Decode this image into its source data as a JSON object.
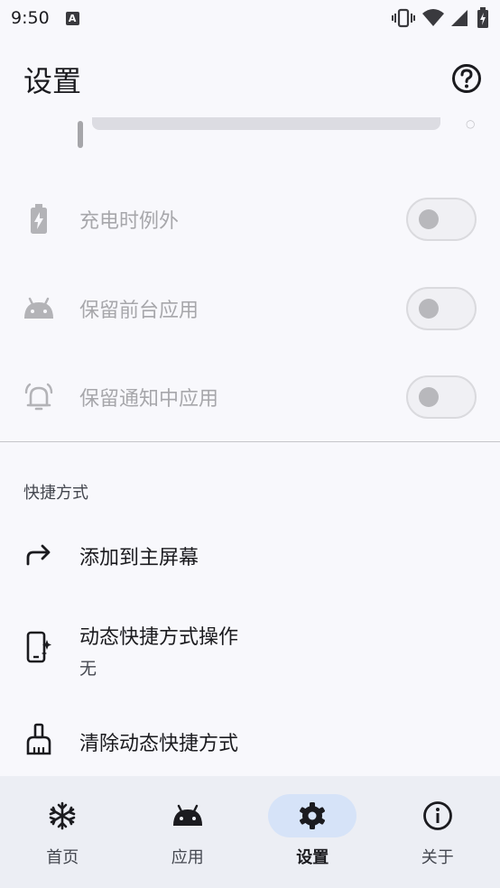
{
  "status_bar": {
    "time": "9:50",
    "left_icon": "A",
    "icons": [
      "vibrate-icon",
      "wifi-icon",
      "signal-icon",
      "battery-charging-icon"
    ]
  },
  "app_bar": {
    "title": "设置",
    "help_icon": "help-circle-icon"
  },
  "exceptions": [
    {
      "label": "充电时例外",
      "icon": "battery-charging-icon",
      "enabled": false,
      "checked": false
    },
    {
      "label": "保留前台应用",
      "icon": "android-icon",
      "enabled": false,
      "checked": false
    },
    {
      "label": "保留通知中应用",
      "icon": "bell-icon",
      "enabled": false,
      "checked": false
    }
  ],
  "shortcuts": {
    "header": "快捷方式",
    "items": [
      {
        "title": "添加到主屏幕",
        "subtitle": "",
        "icon": "share-arrow-icon"
      },
      {
        "title": "动态快捷方式操作",
        "subtitle": "无",
        "icon": "phone-sparkle-icon"
      },
      {
        "title": "清除动态快捷方式",
        "subtitle": "",
        "icon": "broom-icon"
      }
    ]
  },
  "nav": {
    "items": [
      {
        "label": "首页",
        "icon": "snowflake-icon",
        "active": false
      },
      {
        "label": "应用",
        "icon": "android-icon",
        "active": false
      },
      {
        "label": "设置",
        "icon": "gear-icon",
        "active": true
      },
      {
        "label": "关于",
        "icon": "info-icon",
        "active": false
      }
    ]
  },
  "colors": {
    "background": "#f8f8fc",
    "nav_background": "#eceef4",
    "active_pill": "#d6e3f8",
    "disabled_text": "#a7a7ab"
  }
}
